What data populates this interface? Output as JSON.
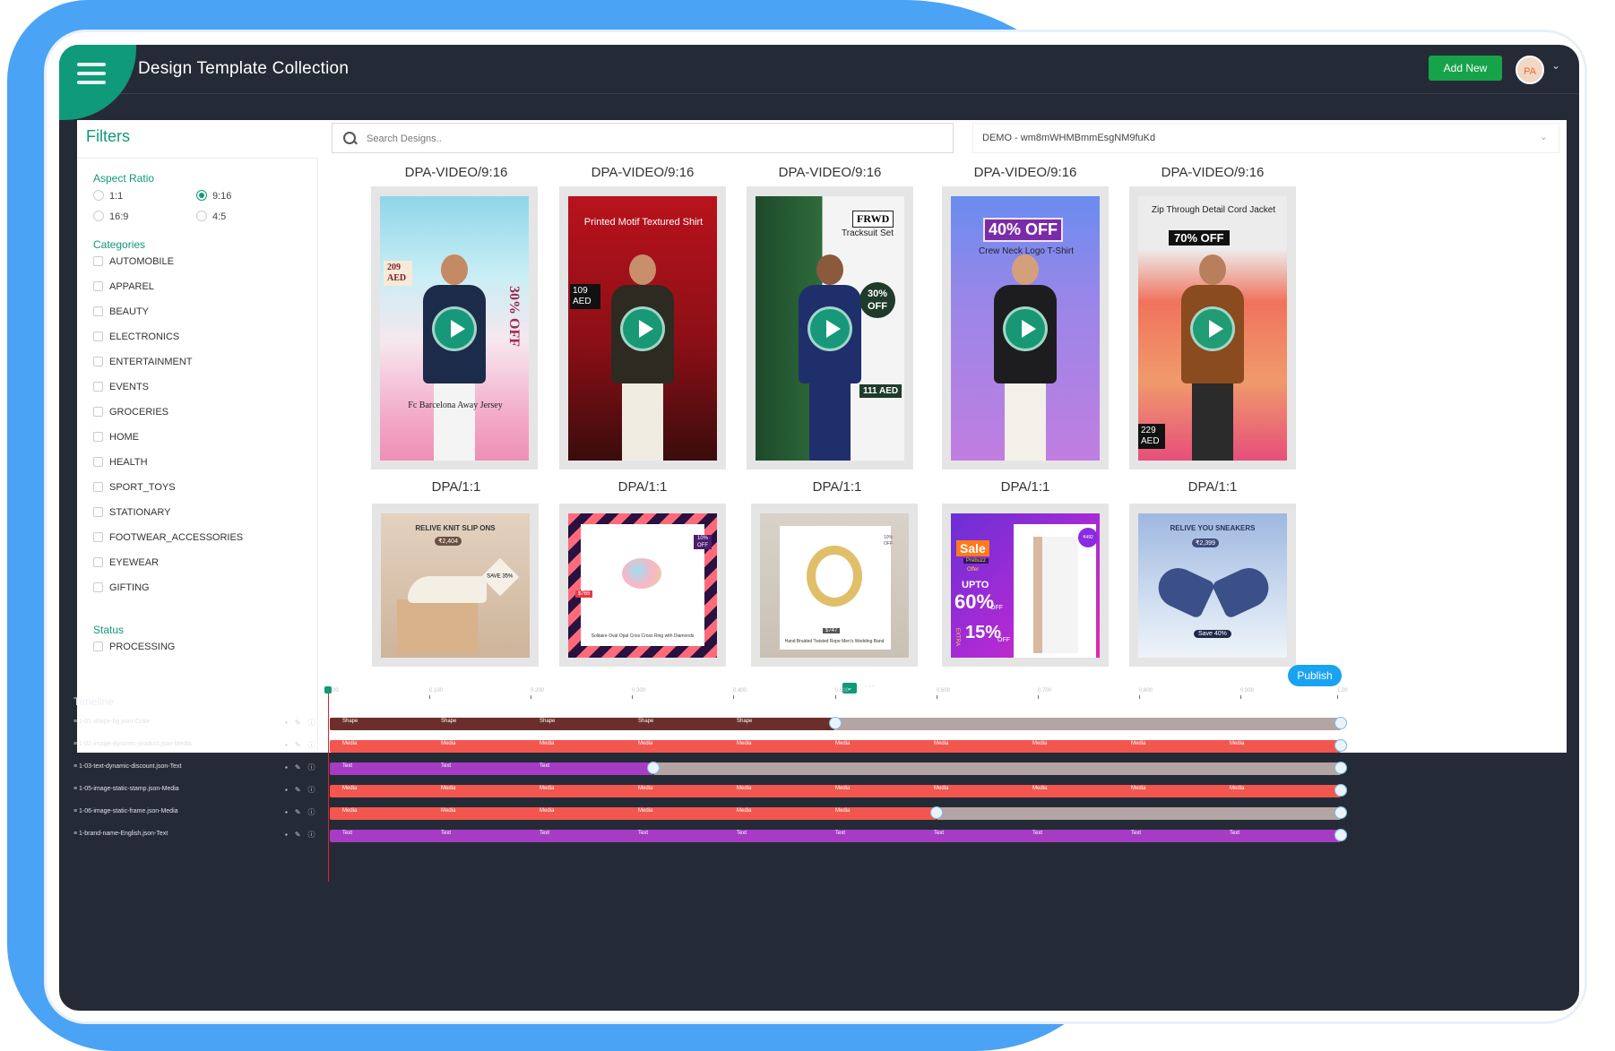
{
  "header": {
    "menu_icon": "hamburger-icon",
    "title": "Design  Template Collection",
    "add_new_label": "Add New",
    "avatar_initials": "PA",
    "accent": "#0f9a7a"
  },
  "filters": {
    "title": "Filters",
    "aspect_ratio": {
      "title": "Aspect Ratio",
      "options": [
        "1:1",
        "9:16",
        "16:9",
        "4:5"
      ],
      "selected": "9:16"
    },
    "categories": {
      "title": "Categories",
      "items": [
        "AUTOMOBILE",
        "APPAREL",
        "BEAUTY",
        "ELECTRONICS",
        "ENTERTAINMENT",
        "EVENTS",
        "GROCERIES",
        "HOME",
        "HEALTH",
        "SPORT_TOYS",
        "STATIONARY",
        "FOOTWEAR_ACCESSORIES",
        "EYEWEAR",
        "GIFTING"
      ]
    },
    "status": {
      "title": "Status",
      "items": [
        "PROCESSING"
      ]
    }
  },
  "search": {
    "placeholder": "Search Designs..",
    "value": ""
  },
  "account_select": {
    "value": "DEMO - wm8mWHMBmmEsgNM9fuKd"
  },
  "cards_row1": [
    {
      "label": "DPA-VIDEO/9:16",
      "texts": [
        "209 AED",
        "30% OFF",
        "Fc Barcelona Away Jersey"
      ]
    },
    {
      "label": "DPA-VIDEO/9:16",
      "texts": [
        "Printed Motif Textured Shirt",
        "109 AED"
      ]
    },
    {
      "label": "DPA-VIDEO/9:16",
      "texts": [
        "FRWD",
        "Tracksuit Set",
        "30% OFF",
        "111 AED"
      ]
    },
    {
      "label": "DPA-VIDEO/9:16",
      "texts": [
        "40% OFF",
        "Crew Neck Logo T-Shirt"
      ]
    },
    {
      "label": "DPA-VIDEO/9:16",
      "texts": [
        "Zip Through Detail Cord Jacket",
        "70% OFF",
        "229 AED"
      ]
    }
  ],
  "cards_row2": [
    {
      "label": "DPA/1:1",
      "texts": [
        "RELIVE KNIT SLIP ONS",
        "₹2,404",
        "SAVE 35%"
      ]
    },
    {
      "label": "DPA/1:1",
      "texts": [
        "10% OFF",
        "$765",
        "Solitaire Oval Opal Criss Cross Ring with Diamonds"
      ]
    },
    {
      "label": "DPA/1:1",
      "texts": [
        "10% OFF",
        "$747",
        "Hand Braided Twisted Rope Men's Wedding Band"
      ]
    },
    {
      "label": "DPA/1:1",
      "texts": [
        "Sale",
        "Prebuzz",
        "Offer",
        "UPTO",
        "60%",
        "OFF",
        "EXTRA",
        "15%",
        "OFF",
        "₹492"
      ]
    },
    {
      "label": "DPA/1:1",
      "texts": [
        "RELIVE YOU SNEAKERS",
        "₹2,399",
        "Save 40%"
      ]
    }
  ],
  "timeline": {
    "title": "Timeline",
    "publish_label": "Publish",
    "ticks": [
      "0.00",
      "0.100",
      "0.200",
      "0.300",
      "0.400",
      "0.500",
      "0.600",
      "0.700",
      "0.800",
      "0.900",
      "1.00"
    ],
    "tracks": [
      {
        "name": "1-01-shape-bg.json-Color",
        "segment": "Shape",
        "color": "#6b2e2a",
        "progress": 0.5
      },
      {
        "name": "1-02-image-dynamic-product.json-Media",
        "segment": "Media",
        "color": "#f2564f",
        "progress": 1.0
      },
      {
        "name": "1-03-text-dynamic-discount.json-Text",
        "segment": "Text",
        "color": "#a63cc4",
        "progress": 0.32
      },
      {
        "name": "1-05-image-static-stamp.json-Media",
        "segment": "Media",
        "color": "#f2564f",
        "progress": 1.0
      },
      {
        "name": "1-06-image-static-frame.json-Media",
        "segment": "Media",
        "color": "#f2564f",
        "progress": 0.6
      },
      {
        "name": "1-brand-name-English.json-Text",
        "segment": "Text",
        "color": "#a63cc4",
        "progress": 1.0
      }
    ]
  }
}
